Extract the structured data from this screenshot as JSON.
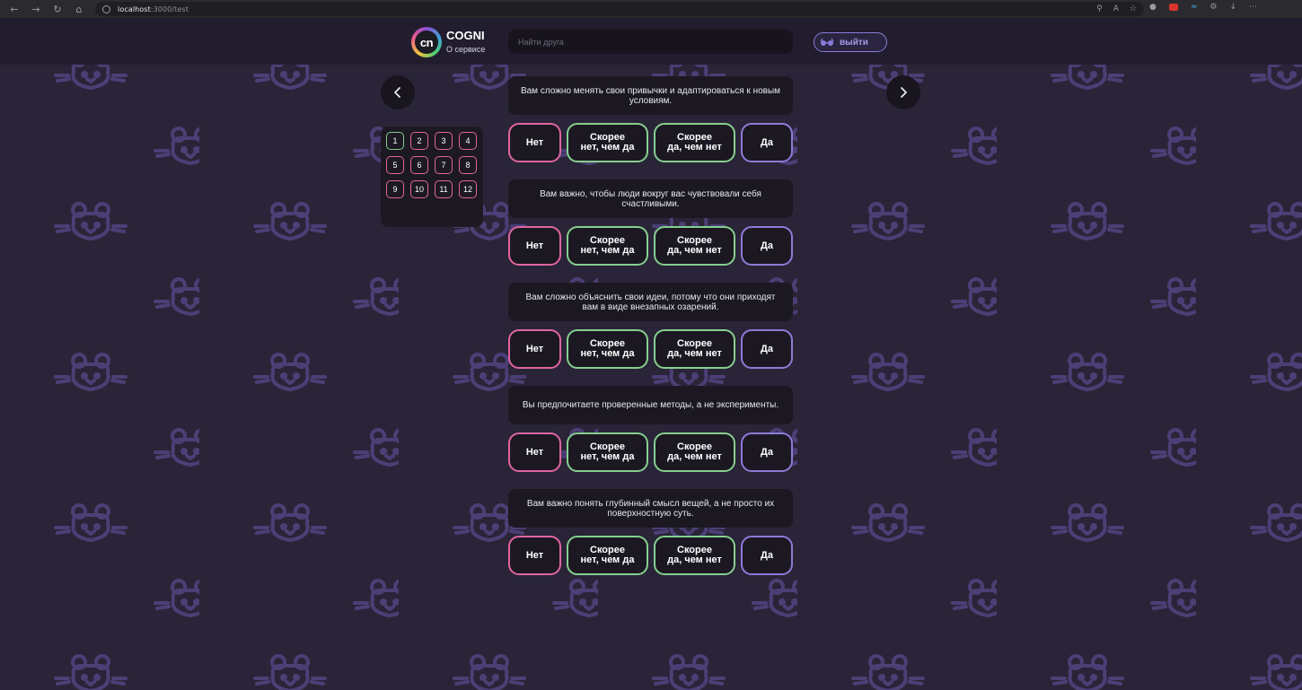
{
  "browser": {
    "url_host": "localhost",
    "url_rest": ":3000/test"
  },
  "header": {
    "logo_text": "cn",
    "brand": "COGNI",
    "about_link": "О сервисе",
    "search_placeholder": "Найти друга",
    "logout_label": "выйти"
  },
  "progress": {
    "numbers": [
      "1",
      "2",
      "3",
      "4",
      "5",
      "6",
      "7",
      "8",
      "9",
      "10",
      "11",
      "12"
    ],
    "active": "1"
  },
  "answer_labels": {
    "no": "Нет",
    "rather_no": "Скорее\nнет, чем да",
    "rather_yes": "Скорее\nда, чем нет",
    "yes": "Да"
  },
  "questions": [
    {
      "text": "Вам сложно менять свои привычки и адаптироваться к новым условиям."
    },
    {
      "text": "Вам важно, чтобы люди вокруг вас чувствовали себя счастливыми."
    },
    {
      "text": "Вам сложно объяснить свои идеи, потому что они приходят вам в виде внезапных озарений."
    },
    {
      "text": "Вы предпочитаете проверенные методы, а не эксперименты."
    },
    {
      "text": "Вам важно понять глубинный смысл вещей, а не просто их поверхностную суть."
    }
  ],
  "colors": {
    "background": "#2a2438",
    "pattern": "#4b3f76",
    "no_border": "#e065a0",
    "middle_border": "#86cf8e",
    "yes_border": "#8d7bd8"
  }
}
